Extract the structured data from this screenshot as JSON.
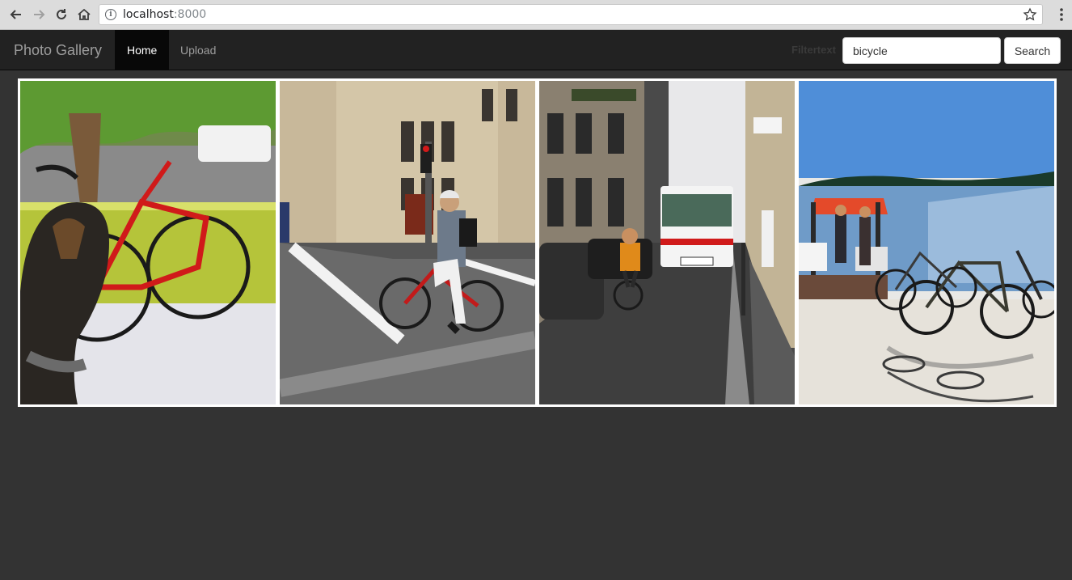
{
  "browser": {
    "url_host": "localhost",
    "url_port": ":8000"
  },
  "navbar": {
    "brand": "Photo Gallery",
    "home_label": "Home",
    "upload_label": "Upload",
    "filter_label": "Filtertext",
    "search_value": "bicycle",
    "search_button_label": "Search"
  },
  "gallery": {
    "photos": [
      {
        "subject": "red road bicycle on porch with dog"
      },
      {
        "subject": "cyclist on mountain bike at city crosswalk"
      },
      {
        "subject": "cyclist on narrow street with truck"
      },
      {
        "subject": "parked bicycles on sandy beach by water"
      }
    ]
  }
}
